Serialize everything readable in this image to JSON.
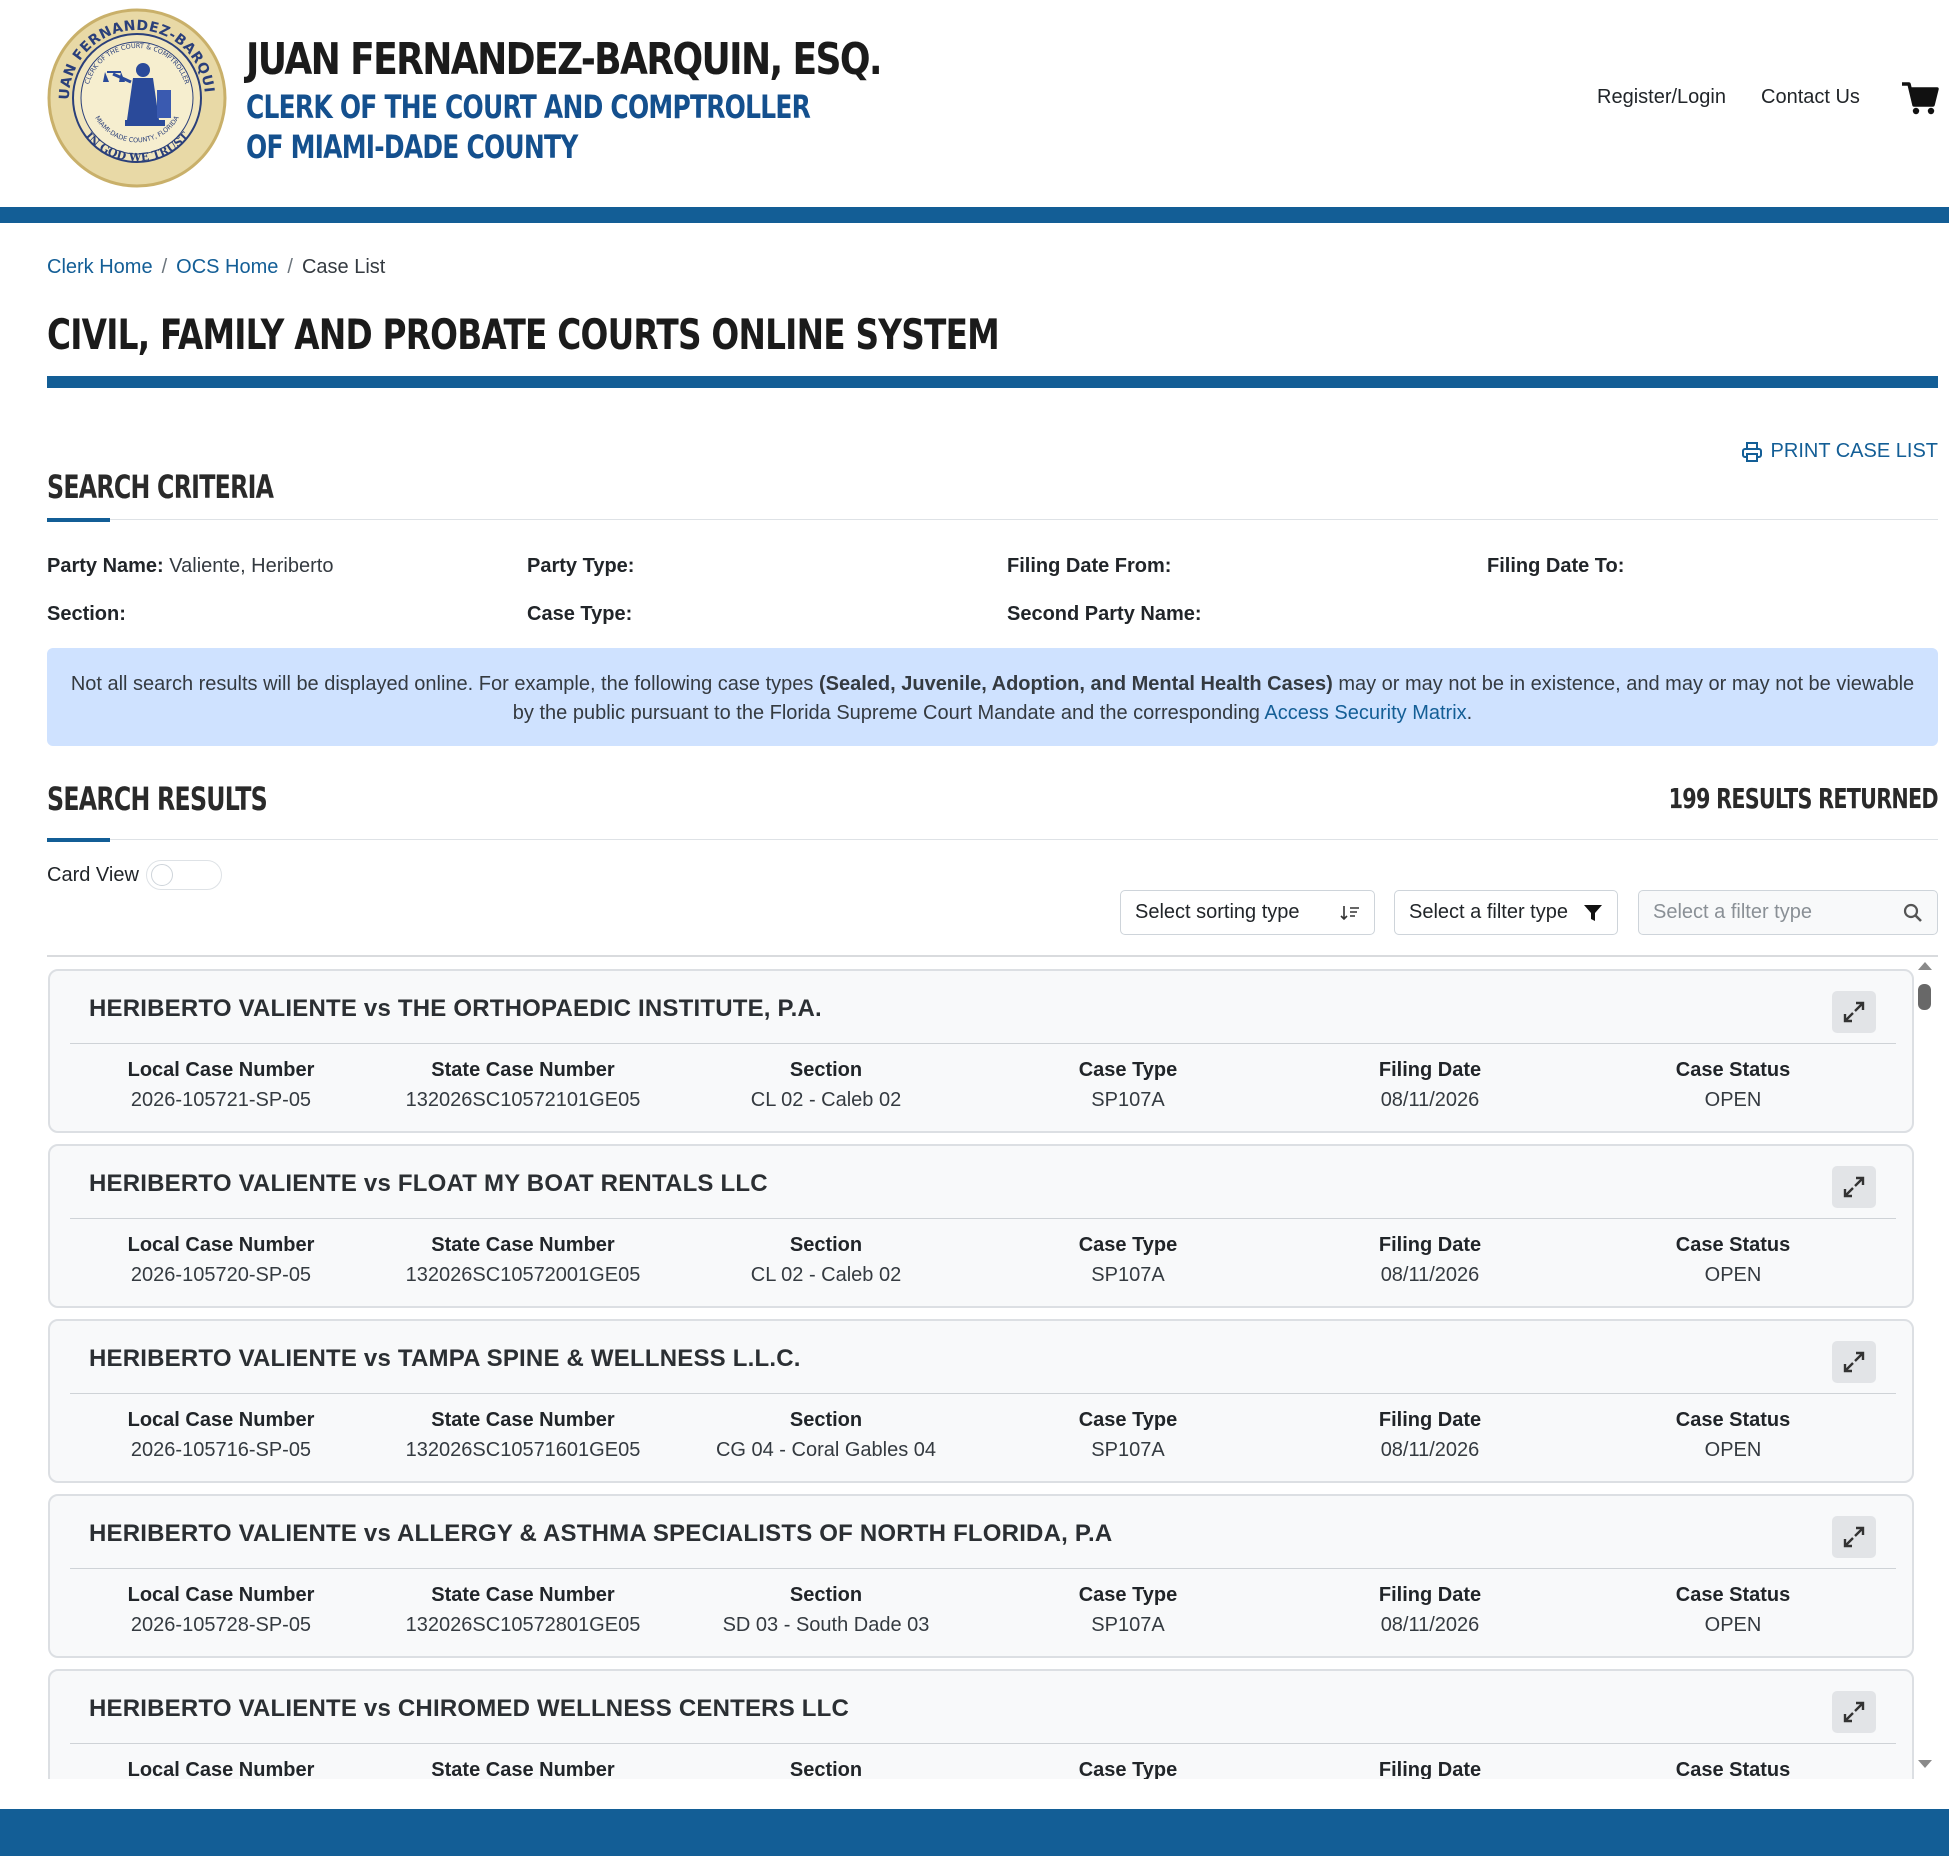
{
  "header": {
    "brand_name": "JUAN FERNANDEZ-BARQUIN, ESQ.",
    "brand_sub_line1": "CLERK OF THE COURT AND COMPTROLLER",
    "brand_sub_line2": "OF MIAMI-DADE COUNTY",
    "seal": {
      "top_text": "JUAN FERNANDEZ-BARQUIN",
      "inner_text": "CLERK OF THE COURT & COMPTROLLER",
      "county_text": "MIAMI-DADE COUNTY, FLORIDA",
      "motto": "IN GOD WE TRUST"
    },
    "nav": {
      "register_login": "Register/Login",
      "contact_us": "Contact Us"
    },
    "cart_icon": "shopping-cart-icon"
  },
  "breadcrumb": {
    "items": [
      "Clerk Home",
      "OCS Home",
      "Case List"
    ],
    "separator": "/"
  },
  "page_title": "CIVIL, FAMILY AND PROBATE COURTS ONLINE SYSTEM",
  "print_link": "PRINT CASE LIST",
  "search_criteria": {
    "heading": "SEARCH CRITERIA",
    "fields": [
      {
        "label": "Party Name:",
        "value": "Valiente, Heriberto"
      },
      {
        "label": "Party Type:",
        "value": ""
      },
      {
        "label": "Filing Date From:",
        "value": ""
      },
      {
        "label": "Filing Date To:",
        "value": ""
      },
      {
        "label": "Section:",
        "value": ""
      },
      {
        "label": "Case Type:",
        "value": ""
      },
      {
        "label": "Second Party Name:",
        "value": ""
      }
    ]
  },
  "notice": {
    "text_before": "Not all search results will be displayed online. For example, the following case types ",
    "bold": "(Sealed, Juvenile, Adoption, and Mental Health Cases)",
    "text_middle": " may or may not be in existence, and may or may not be viewable by the public pursuant to the Florida Supreme Court Mandate and the corresponding ",
    "link": "Access Security Matrix",
    "text_after": "."
  },
  "search_results": {
    "heading": "SEARCH RESULTS",
    "count_text": "199 RESULTS RETURNED",
    "card_view_label": "Card View",
    "card_view_on": false,
    "sort_placeholder": "Select sorting type",
    "filter_type_placeholder": "Select a filter type",
    "filter_value_placeholder": "Select a filter type",
    "columns": [
      "Local Case Number",
      "State Case Number",
      "Section",
      "Case Type",
      "Filing Date",
      "Case Status"
    ],
    "cases": [
      {
        "title": "HERIBERTO VALIENTE vs THE ORTHOPAEDIC INSTITUTE, P.A.",
        "local": "2026-105721-SP-05",
        "state": "132026SC10572101GE05",
        "section": "CL 02 - Caleb 02",
        "type": "SP107A",
        "date": "08/11/2026",
        "status": "OPEN"
      },
      {
        "title": "HERIBERTO VALIENTE vs FLOAT MY BOAT RENTALS LLC",
        "local": "2026-105720-SP-05",
        "state": "132026SC10572001GE05",
        "section": "CL 02 - Caleb 02",
        "type": "SP107A",
        "date": "08/11/2026",
        "status": "OPEN"
      },
      {
        "title": "HERIBERTO VALIENTE vs TAMPA SPINE & WELLNESS L.L.C.",
        "local": "2026-105716-SP-05",
        "state": "132026SC10571601GE05",
        "section": "CG 04 - Coral Gables 04",
        "type": "SP107A",
        "date": "08/11/2026",
        "status": "OPEN"
      },
      {
        "title": "HERIBERTO VALIENTE vs ALLERGY & ASTHMA SPECIALISTS OF NORTH FLORIDA, P.A",
        "local": "2026-105728-SP-05",
        "state": "132026SC10572801GE05",
        "section": "SD 03 - South Dade 03",
        "type": "SP107A",
        "date": "08/11/2026",
        "status": "OPEN"
      },
      {
        "title": "HERIBERTO VALIENTE vs CHIROMED WELLNESS CENTERS LLC",
        "local": "",
        "state": "",
        "section": "",
        "type": "",
        "date": "",
        "status": ""
      }
    ]
  },
  "colors": {
    "brand_blue": "#135e96",
    "notice_bg": "#cfe2ff",
    "card_bg": "#f8f9fa"
  }
}
